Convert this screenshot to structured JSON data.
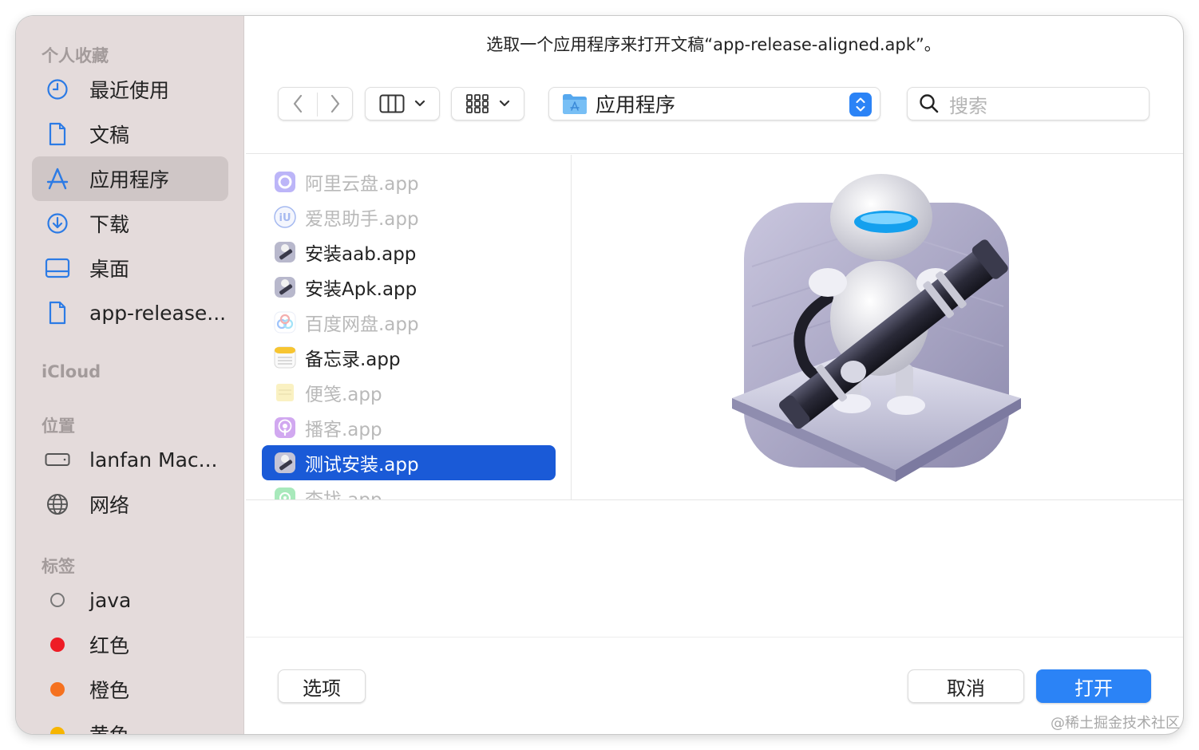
{
  "dialog": {
    "title": "选取一个应用程序来打开文稿“app-release-aligned.apk”。"
  },
  "sidebar": {
    "favorites_header": "个人收藏",
    "favorites": [
      {
        "label": "最近使用",
        "icon": "clock-icon"
      },
      {
        "label": "文稿",
        "icon": "document-icon"
      },
      {
        "label": "应用程序",
        "icon": "applications-icon",
        "active": true
      },
      {
        "label": "下载",
        "icon": "download-icon"
      },
      {
        "label": "桌面",
        "icon": "desktop-icon"
      },
      {
        "label": "app-release...",
        "icon": "document-icon"
      }
    ],
    "icloud_header": "iCloud",
    "locations_header": "位置",
    "locations": [
      {
        "label": "lanfan Mac...",
        "icon": "disk-icon"
      },
      {
        "label": "网络",
        "icon": "globe-icon"
      }
    ],
    "tags_header": "标签",
    "tags": [
      {
        "label": "java",
        "color": "none"
      },
      {
        "label": "红色",
        "color": "#ee1c25"
      },
      {
        "label": "橙色",
        "color": "#f5711f"
      },
      {
        "label": "黄色",
        "color": "#f7b500"
      }
    ]
  },
  "toolbar": {
    "back_icon": "chevron-left-icon",
    "forward_icon": "chevron-right-icon",
    "view_columns_icon": "columns-view-icon",
    "view_grid_icon": "grid-view-icon",
    "location": "应用程序",
    "search_placeholder": "搜索"
  },
  "files": [
    {
      "name": "阿里云盘.app",
      "state": "dim",
      "icon": "aliyun-icon"
    },
    {
      "name": "爱思助手.app",
      "state": "dim",
      "icon": "i4-icon"
    },
    {
      "name": "安装aab.app",
      "state": "normal",
      "icon": "automator-icon"
    },
    {
      "name": "安装Apk.app",
      "state": "normal",
      "icon": "automator-icon"
    },
    {
      "name": "百度网盘.app",
      "state": "dim",
      "icon": "baidu-icon"
    },
    {
      "name": "备忘录.app",
      "state": "normal",
      "icon": "notes-icon"
    },
    {
      "name": "便笺.app",
      "state": "dim",
      "icon": "stickies-icon"
    },
    {
      "name": "播客.app",
      "state": "dim",
      "icon": "podcasts-icon"
    },
    {
      "name": "测试安装.app",
      "state": "selected",
      "icon": "automator-icon"
    },
    {
      "name": "查找.app",
      "state": "dim",
      "icon": "findmy-icon"
    }
  ],
  "footer": {
    "options_label": "选项",
    "cancel_label": "取消",
    "open_label": "打开"
  },
  "watermark": "@稀土掘金技术社区",
  "colors": {
    "accent": "#2b83f6",
    "selection": "#1a5ad7",
    "sidebar_bg": "#e4dbdb"
  }
}
